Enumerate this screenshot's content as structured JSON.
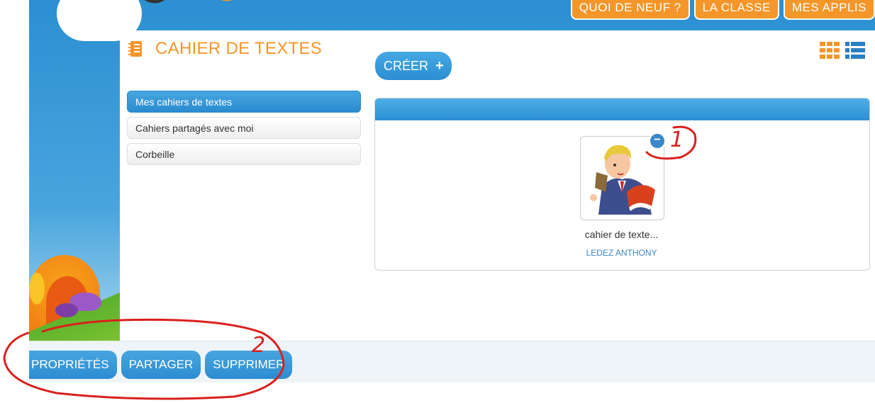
{
  "topnav": {
    "items": [
      "QUOI DE NEUF ?",
      "LA CLASSE",
      "MES APPLIS"
    ]
  },
  "page": {
    "title": "CAHIER DE TEXTES",
    "create_label": "CRÉER"
  },
  "sidebar": {
    "items": [
      {
        "label": "Mes cahiers de textes",
        "active": true
      },
      {
        "label": "Cahiers partagés avec moi",
        "active": false
      },
      {
        "label": "Corbeille",
        "active": false
      }
    ]
  },
  "card": {
    "name": "cahier de texte...",
    "owner": "LEDEZ ANTHONY",
    "badge": "−"
  },
  "footer": {
    "buttons": [
      "PROPRIÉTÉS",
      "PARTAGER",
      "SUPPRIMER"
    ]
  },
  "annotations": {
    "mark1": "1",
    "mark2": "2"
  },
  "colors": {
    "accent_orange": "#f5962a",
    "accent_blue": "#2b8fd3",
    "annotation_red": "#d9201c"
  }
}
